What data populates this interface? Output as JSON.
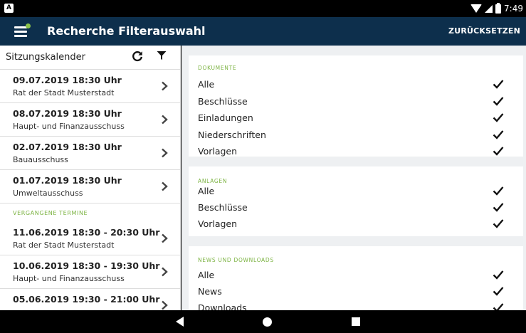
{
  "status_bar": {
    "notification_icon": "A",
    "time": "7:49",
    "icons": [
      "wifi-icon",
      "signal-icon",
      "battery-icon"
    ]
  },
  "app_bar": {
    "title": "Recherche Filterauswahl",
    "reset_label": "ZURÜCKSETZEN",
    "menu_icon": "hamburger-menu-icon"
  },
  "sidebar": {
    "title": "Sitzungskalender",
    "refresh_icon": "refresh-icon",
    "filter_icon": "filter-icon",
    "upcoming": [
      {
        "date": "09.07.2019 18:30 Uhr",
        "body": "Rat der Stadt Musterstadt"
      },
      {
        "date": "08.07.2019 18:30 Uhr",
        "body": "Haupt- und Finanzausschuss"
      },
      {
        "date": "02.07.2019 18:30 Uhr",
        "body": "Bauausschuss"
      },
      {
        "date": "01.07.2019 18:30 Uhr",
        "body": "Umweltausschuss"
      }
    ],
    "past_label": "VERGANGENE TERMINE",
    "past": [
      {
        "date": "11.06.2019 18:30 - 20:30 Uhr",
        "body": "Rat der Stadt Musterstadt"
      },
      {
        "date": "10.06.2019 18:30 - 19:30 Uhr",
        "body": "Haupt- und Finanzausschuss"
      },
      {
        "date": "05.06.2019 19:30 - 21:00 Uhr",
        "body": ""
      }
    ]
  },
  "filters": {
    "dokumente": {
      "heading": "DOKUMENTE",
      "items": [
        "Alle",
        "Beschlüsse",
        "Einladungen",
        "Niederschriften",
        "Vorlagen"
      ]
    },
    "anlagen": {
      "heading": "ANLAGEN",
      "items": [
        "Alle",
        "Beschlüsse",
        "Vorlagen"
      ]
    },
    "news": {
      "heading": "NEWS UND DOWNLOADS",
      "items": [
        "Alle",
        "News",
        "Downloads"
      ]
    }
  },
  "colors": {
    "app_bar": "#0d2f4c",
    "accent_green": "#7cb342",
    "panel_background": "#eef0f2"
  },
  "nav_bar": {
    "icons": [
      "back-icon",
      "home-icon",
      "recent-apps-icon"
    ]
  }
}
